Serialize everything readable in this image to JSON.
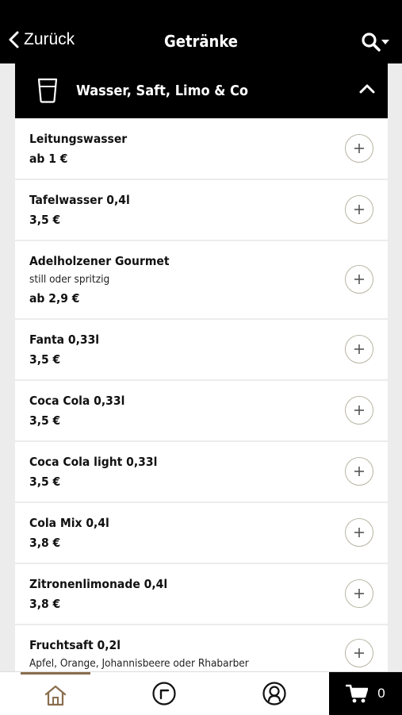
{
  "header": {
    "back_label": "Zurück",
    "title": "Getränke"
  },
  "category": {
    "title": "Wasser, Saft, Limo & Co",
    "icon": "glass-icon",
    "expanded": true
  },
  "items": [
    {
      "name": "Leitungswasser",
      "desc": "",
      "price": "ab 1 €"
    },
    {
      "name": "Tafelwasser 0,4l",
      "desc": "",
      "price": "3,5 €"
    },
    {
      "name": "Adelholzener Gourmet",
      "desc": "still oder spritzig",
      "price": "ab 2,9 €"
    },
    {
      "name": "Fanta 0,33l",
      "desc": "",
      "price": "3,5 €"
    },
    {
      "name": "Coca Cola 0,33l",
      "desc": "",
      "price": "3,5 €"
    },
    {
      "name": "Coca Cola light  0,33l",
      "desc": "",
      "price": "3,5 €"
    },
    {
      "name": "Cola Mix 0,4l",
      "desc": "",
      "price": "3,8 €"
    },
    {
      "name": "Zitronenlimonade 0,4l",
      "desc": "",
      "price": "3,8 €"
    },
    {
      "name": "Fruchtsaft 0,2l",
      "desc": "Apfel, Orange, Johannisbeere oder Rhabarber",
      "price": ""
    }
  ],
  "bottom_nav": {
    "tabs": [
      "home-icon",
      "clock-icon",
      "account-icon"
    ],
    "active": "home-icon",
    "cart_count": "0"
  },
  "colors": {
    "bar": "#000000",
    "background": "#ececec",
    "accent": "#8a6d4e",
    "add_border": "#b8b5a4"
  }
}
